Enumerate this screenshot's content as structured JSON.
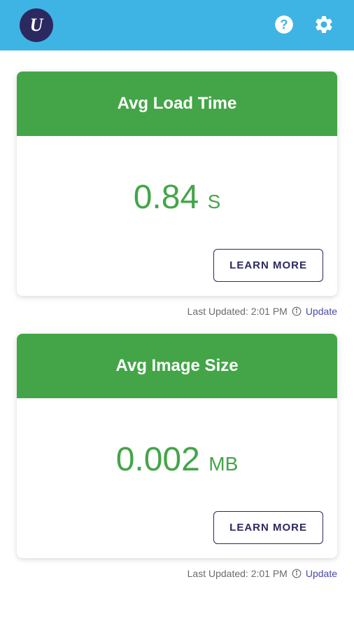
{
  "header": {
    "logo_text": "U",
    "help_icon": "help-icon",
    "settings_icon": "settings-icon"
  },
  "cards": [
    {
      "title": "Avg Load Time",
      "value": "0.84",
      "unit": "S",
      "learn_more_label": "LEARN MORE",
      "last_updated_label": "Last Updated: 2:01 PM",
      "update_link": "Update"
    },
    {
      "title": "Avg Image Size",
      "value": "0.002",
      "unit": "MB",
      "learn_more_label": "LEARN MORE",
      "last_updated_label": "Last Updated: 2:01 PM",
      "update_link": "Update"
    }
  ]
}
